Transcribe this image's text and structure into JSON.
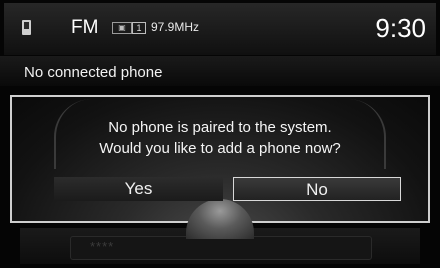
{
  "status_bar": {
    "band": "FM",
    "preset_icon_text": "▣",
    "preset_number": "1",
    "frequency": "97.9MHz",
    "time": "9:30"
  },
  "header": {
    "title": "No connected phone"
  },
  "dialog": {
    "message_line1": "No phone is paired to the system.",
    "message_line2": "Would you like to add a phone now?",
    "yes_label": "Yes",
    "no_label": "No",
    "selected": "No"
  },
  "background": {
    "masked_field": "****"
  },
  "colors": {
    "background": "#050505",
    "text": "#f2f2f2",
    "focus_border": "#d8d8d8"
  }
}
